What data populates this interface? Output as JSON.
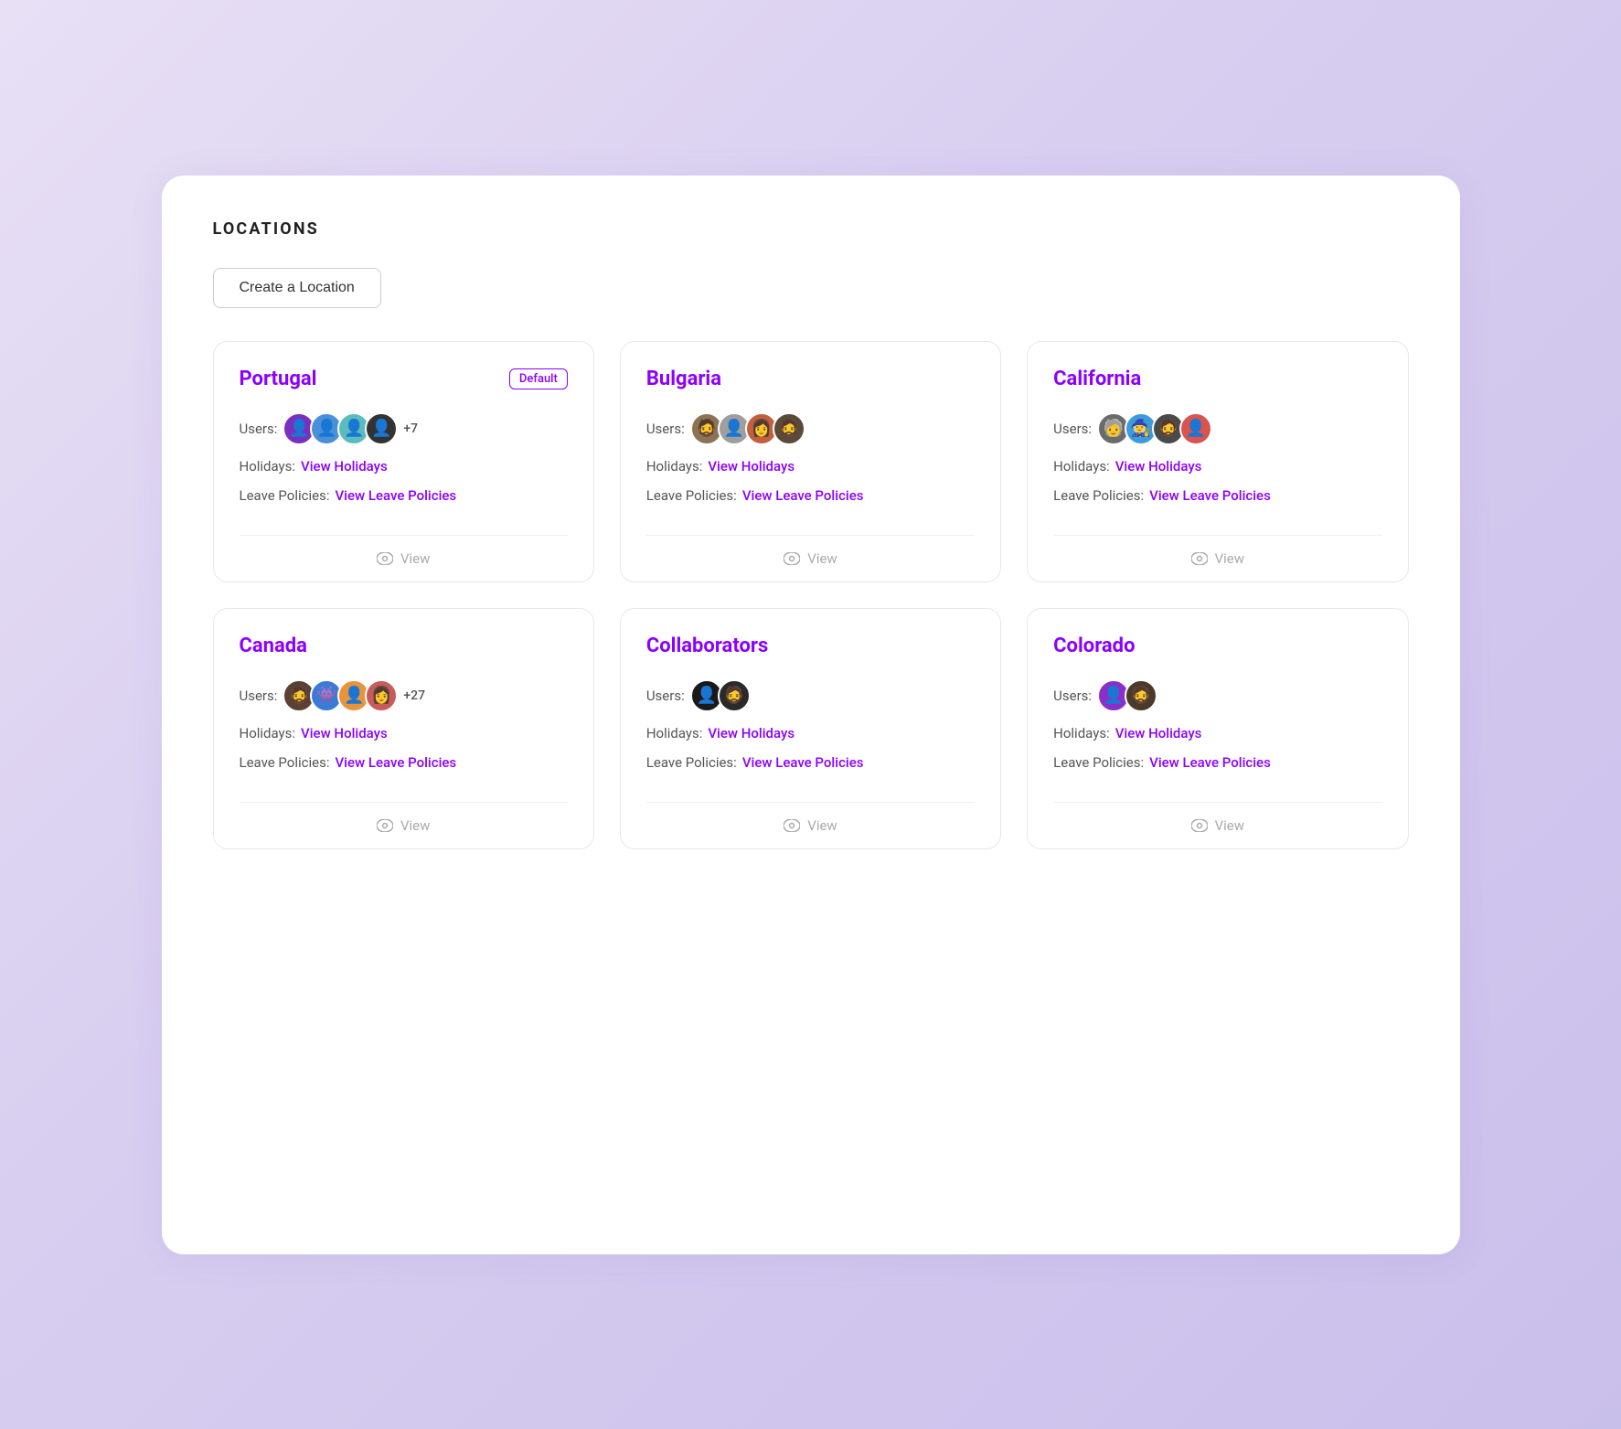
{
  "page": {
    "title": "LOCATIONS",
    "create_button": "Create a Location"
  },
  "locations": [
    {
      "id": "portugal",
      "name": "Portugal",
      "default": true,
      "default_label": "Default",
      "user_count": "+7",
      "holidays_label": "Holidays:",
      "holidays_link": "View Holidays",
      "policies_label": "Leave Policies:",
      "policies_link": "View Leave Policies",
      "view_label": "View",
      "avatars": [
        "purple-f",
        "blue-f",
        "teal-f",
        "dark-f"
      ]
    },
    {
      "id": "bulgaria",
      "name": "Bulgaria",
      "default": false,
      "default_label": "",
      "user_count": null,
      "holidays_label": "Holidays:",
      "holidays_link": "View Holidays",
      "policies_label": "Leave Policies:",
      "policies_link": "View Leave Policies",
      "view_label": "View",
      "avatars": [
        "photo-m1",
        "gray-f",
        "photo-f1",
        "photo-m2"
      ]
    },
    {
      "id": "california",
      "name": "California",
      "default": false,
      "default_label": "",
      "user_count": null,
      "holidays_label": "Holidays:",
      "holidays_link": "View Holidays",
      "policies_label": "Leave Policies:",
      "policies_link": "View Leave Policies",
      "view_label": "View",
      "avatars": [
        "photo-m3",
        "smurf",
        "photo-m4",
        "red-f"
      ]
    },
    {
      "id": "canada",
      "name": "Canada",
      "default": false,
      "default_label": "",
      "user_count": "+27",
      "holidays_label": "Holidays:",
      "holidays_link": "View Holidays",
      "policies_label": "Leave Policies:",
      "policies_link": "View Leave Policies",
      "view_label": "View",
      "avatars": [
        "photo-m5",
        "stitch",
        "orange-f",
        "photo-f2"
      ]
    },
    {
      "id": "collaborators",
      "name": "Collaborators",
      "default": false,
      "default_label": "",
      "user_count": null,
      "holidays_label": "Holidays:",
      "holidays_link": "View Holidays",
      "policies_label": "Leave Policies:",
      "policies_link": "View Leave Policies",
      "view_label": "View",
      "avatars": [
        "dark-m1",
        "dark-m2"
      ]
    },
    {
      "id": "colorado",
      "name": "Colorado",
      "default": false,
      "default_label": "",
      "user_count": null,
      "holidays_label": "Holidays:",
      "holidays_link": "View Holidays",
      "policies_label": "Leave Policies:",
      "policies_link": "View Leave Policies",
      "view_label": "View",
      "avatars": [
        "purple2-f",
        "photo-m6"
      ]
    }
  ],
  "icons": {
    "eye": "👁",
    "users_label": "Users:"
  }
}
